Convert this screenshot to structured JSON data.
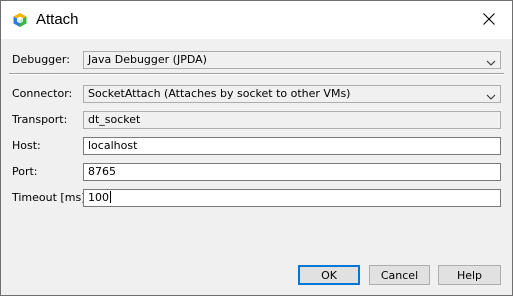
{
  "window": {
    "title": "Attach",
    "app_icon": "netbeans-cube-icon",
    "close_icon": "close-icon"
  },
  "form": {
    "debugger": {
      "label": "Debugger:",
      "value": "Java Debugger (JPDA)"
    },
    "connector": {
      "label": "Connector:",
      "value": "SocketAttach (Attaches by socket to other VMs)"
    },
    "transport": {
      "label": "Transport:",
      "value": "dt_socket"
    },
    "host": {
      "label": "Host:",
      "value": "localhost"
    },
    "port": {
      "label": "Port:",
      "value": "8765"
    },
    "timeout": {
      "label": "Timeout [ms]:",
      "value": "100"
    }
  },
  "buttons": {
    "ok": "OK",
    "cancel": "Cancel",
    "help": "Help"
  },
  "colors": {
    "default_button_border": "#0078d7",
    "dialog_background": "#f0f0f0"
  }
}
